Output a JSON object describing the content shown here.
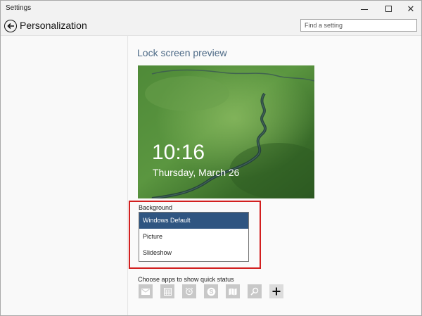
{
  "window": {
    "title": "Settings"
  },
  "header": {
    "title": "Personalization",
    "search_placeholder": "Find a setting"
  },
  "lockscreen": {
    "section_title": "Lock screen preview",
    "time": "10:16",
    "date": "Thursday, March 26"
  },
  "background": {
    "label": "Background",
    "options": [
      "Windows Default",
      "Picture",
      "Slideshow"
    ],
    "selected": "Windows Default"
  },
  "quick_status": {
    "label": "Choose apps to show quick status",
    "icons": [
      "mail-icon",
      "calendar-icon",
      "alarm-icon",
      "skype-icon",
      "maps-icon",
      "search-icon",
      "add-icon"
    ]
  },
  "colors": {
    "accent": "#2f5581",
    "title": "#4d6a86",
    "highlight": "#d21f1f"
  }
}
